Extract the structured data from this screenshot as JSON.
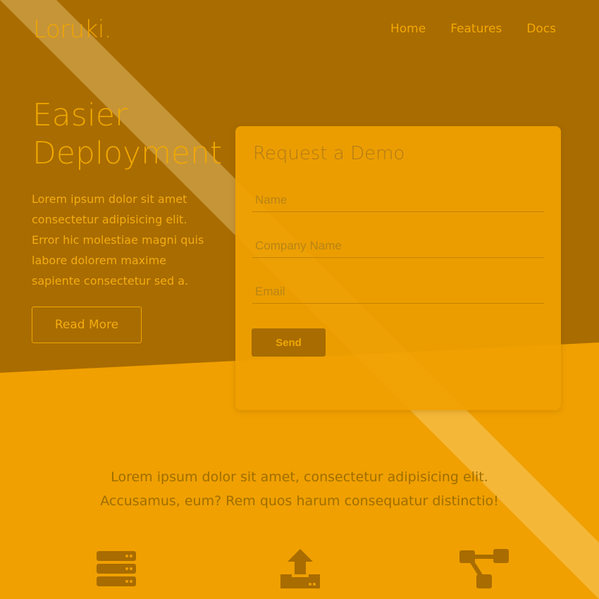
{
  "brand": {
    "logo": "Loruki."
  },
  "nav": {
    "items": [
      "Home",
      "Features",
      "Docs"
    ]
  },
  "hero": {
    "title_line1": "Easier",
    "title_line2": "Deployment",
    "text": "Lorem ipsum dolor sit amet consectetur adipisicing elit. Error hic molestiae magni quis labore dolorem maxime sapiente consectetur sed a.",
    "read_more_label": "Read More"
  },
  "demo_form": {
    "title": "Request a Demo",
    "name_placeholder": "Name",
    "company_placeholder": "Company Name",
    "email_placeholder": "Email",
    "send_label": "Send"
  },
  "tagline": {
    "line1": "Lorem ipsum dolor sit amet, consectetur adipisicing elit.",
    "line2": "Accusamus, eum? Rem quos harum consequatur distinctio!"
  },
  "features": {
    "icons": [
      "server-icon",
      "upload-icon",
      "network-icon"
    ]
  },
  "colors": {
    "primary": "#f0a000",
    "dark": "#a86c00",
    "text_dark": "#9e6e00"
  }
}
